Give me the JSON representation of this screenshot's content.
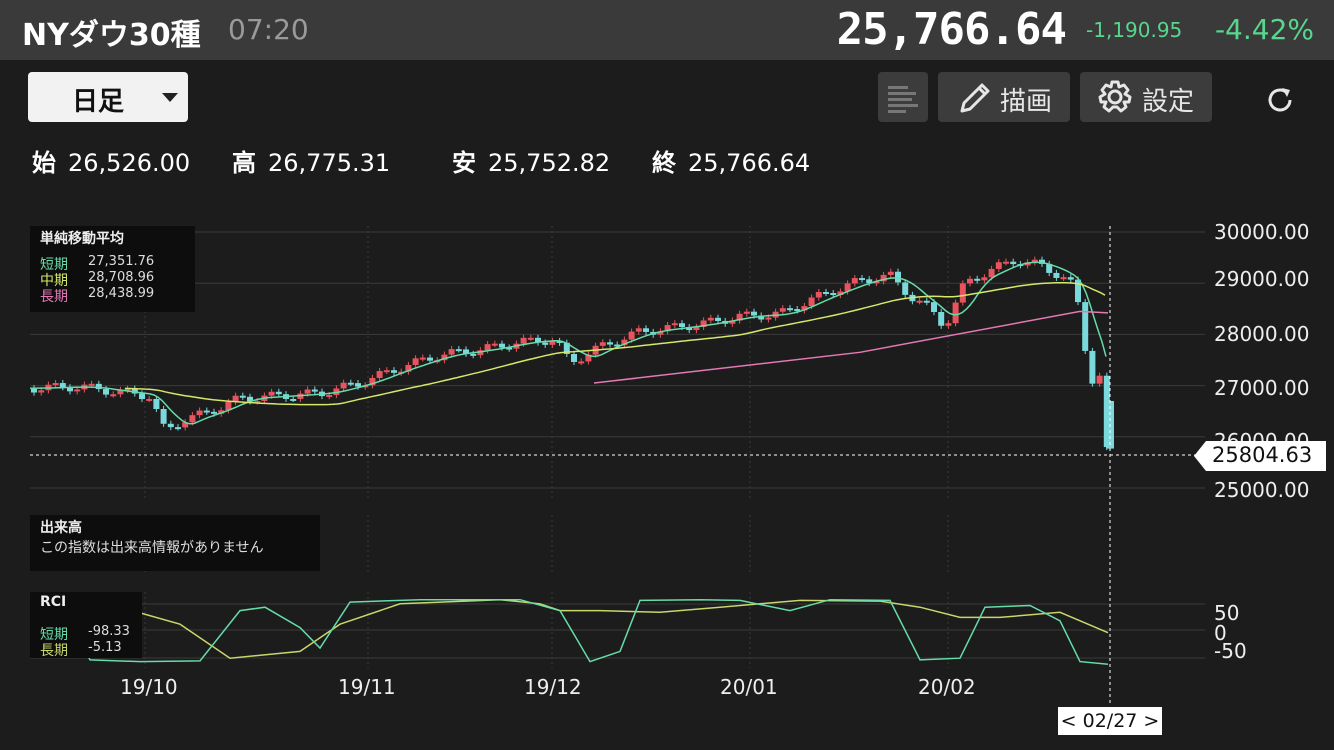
{
  "header": {
    "title": "NYダウ30種",
    "time": "07:20",
    "price": "25,766.64",
    "change": "-1,190.95",
    "change_pct": "-4.42%"
  },
  "toolbar": {
    "period": "日足",
    "draw_label": "描画",
    "settings_label": "設定"
  },
  "ohlc": {
    "open_label": "始",
    "open": "26,526.00",
    "high_label": "高",
    "high": "26,775.31",
    "low_label": "安",
    "low": "25,752.82",
    "close_label": "終",
    "close": "25,766.64"
  },
  "sma_legend": {
    "title": "単純移動平均",
    "rows": [
      {
        "label": "短期",
        "value": "27,351.76",
        "color": "#66dca8"
      },
      {
        "label": "中期",
        "value": "28,708.96",
        "color": "#d4e86a"
      },
      {
        "label": "長期",
        "value": "28,438.99",
        "color": "#e479b4"
      }
    ]
  },
  "volume_legend": {
    "title": "出来高",
    "message": "この指数は出来高情報がありません"
  },
  "rci_legend": {
    "title": "RCI",
    "rows": [
      {
        "label": "短期",
        "value": "-98.33",
        "color": "#66dca8"
      },
      {
        "label": "長期",
        "value": "-5.13",
        "color": "#c9d66a"
      }
    ]
  },
  "price_axis": [
    "30000.00",
    "29000.00",
    "28000.00",
    "27000.00",
    "26000.00",
    "25000.00"
  ],
  "rci_axis": [
    "50",
    "0",
    "-50"
  ],
  "x_axis": [
    "19/10",
    "19/11",
    "19/12",
    "20/01",
    "20/02"
  ],
  "current_price_tag": "25804.63",
  "crosshair_date": "< 02/27 >",
  "colors": {
    "up": "#e8545e",
    "down": "#7ad9dc",
    "short_ma": "#66dca8",
    "mid_ma": "#d4e86a",
    "long_ma": "#e479b4",
    "rci_long": "#c9d66a"
  }
}
